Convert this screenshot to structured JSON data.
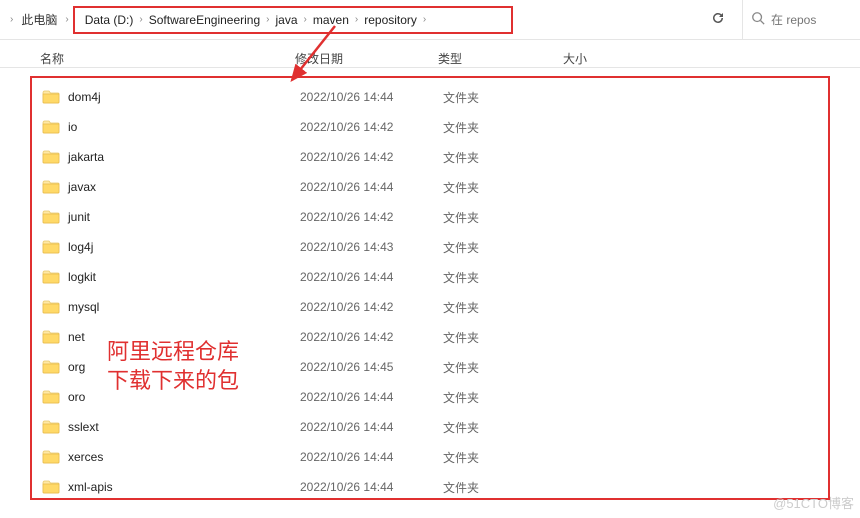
{
  "breadcrumb": {
    "prefix": "此电脑",
    "items": [
      "Data (D:)",
      "SoftwareEngineering",
      "java",
      "maven",
      "repository"
    ]
  },
  "search": {
    "placeholder": "在 repos"
  },
  "columns": {
    "name": "名称",
    "date": "修改日期",
    "type": "类型",
    "size": "大小"
  },
  "type_label": "文件夹",
  "rows": [
    {
      "name": "dom4j",
      "date": "2022/10/26 14:44"
    },
    {
      "name": "io",
      "date": "2022/10/26 14:42"
    },
    {
      "name": "jakarta",
      "date": "2022/10/26 14:42"
    },
    {
      "name": "javax",
      "date": "2022/10/26 14:44"
    },
    {
      "name": "junit",
      "date": "2022/10/26 14:42"
    },
    {
      "name": "log4j",
      "date": "2022/10/26 14:43"
    },
    {
      "name": "logkit",
      "date": "2022/10/26 14:44"
    },
    {
      "name": "mysql",
      "date": "2022/10/26 14:42"
    },
    {
      "name": "net",
      "date": "2022/10/26 14:42"
    },
    {
      "name": "org",
      "date": "2022/10/26 14:45"
    },
    {
      "name": "oro",
      "date": "2022/10/26 14:44"
    },
    {
      "name": "sslext",
      "date": "2022/10/26 14:44"
    },
    {
      "name": "xerces",
      "date": "2022/10/26 14:44"
    },
    {
      "name": "xml-apis",
      "date": "2022/10/26 14:44"
    }
  ],
  "annotation": {
    "line1": "阿里远程仓库",
    "line2": "下载下来的包"
  },
  "watermark": "@51CTO博客"
}
